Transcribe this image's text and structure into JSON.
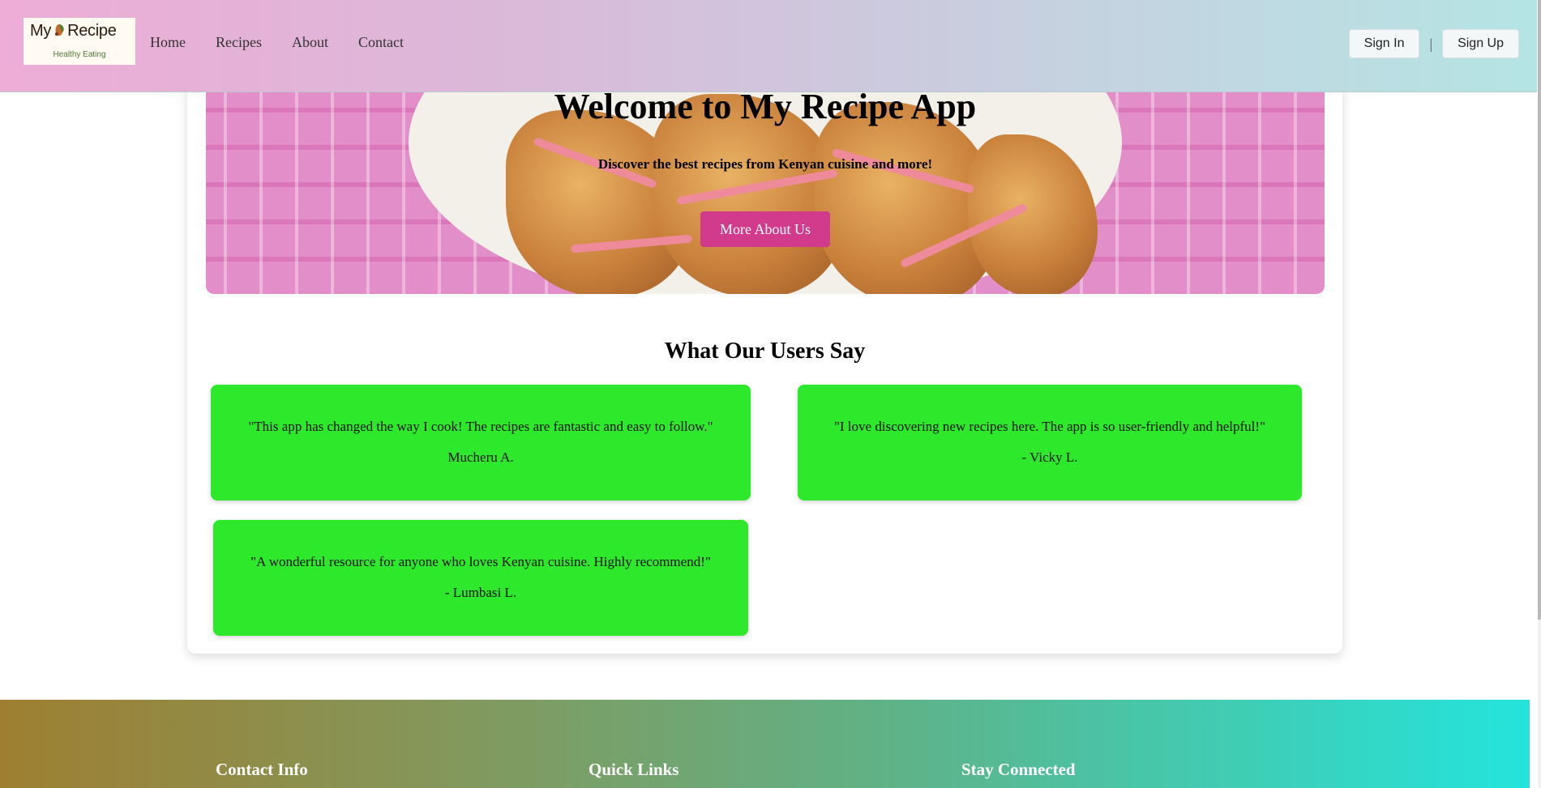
{
  "header": {
    "logo": {
      "main_prefix": "My",
      "main_suffix": "Recipe",
      "tagline": "Healthy Eating"
    },
    "nav": [
      "Home",
      "Recipes",
      "About",
      "Contact"
    ],
    "auth": {
      "sign_in": "Sign In",
      "separator": "|",
      "sign_up": "Sign Up"
    }
  },
  "hero": {
    "title": "Welcome to My Recipe App",
    "subtitle": "Discover the best recipes from Kenyan cuisine and more!",
    "button": "More About Us"
  },
  "testimonials": {
    "heading": "What Our Users Say",
    "items": [
      {
        "quote": "\"This app has changed the way I cook! The recipes are fantastic and easy to follow.\"",
        "author": "Mucheru A."
      },
      {
        "quote": "\"I love discovering new recipes here. The app is so user-friendly and helpful!\"",
        "author": "- Vicky L."
      },
      {
        "quote": "\"A wonderful resource for anyone who loves Kenyan cuisine. Highly recommend!\"",
        "author": "- Lumbasi L."
      }
    ]
  },
  "footer": {
    "columns": [
      "Contact Info",
      "Quick Links",
      "Stay Connected"
    ]
  },
  "colors": {
    "testimonial_bg": "#2ee82c",
    "hero_button": "#d23b8c",
    "logo_green": "#4f7a35"
  }
}
